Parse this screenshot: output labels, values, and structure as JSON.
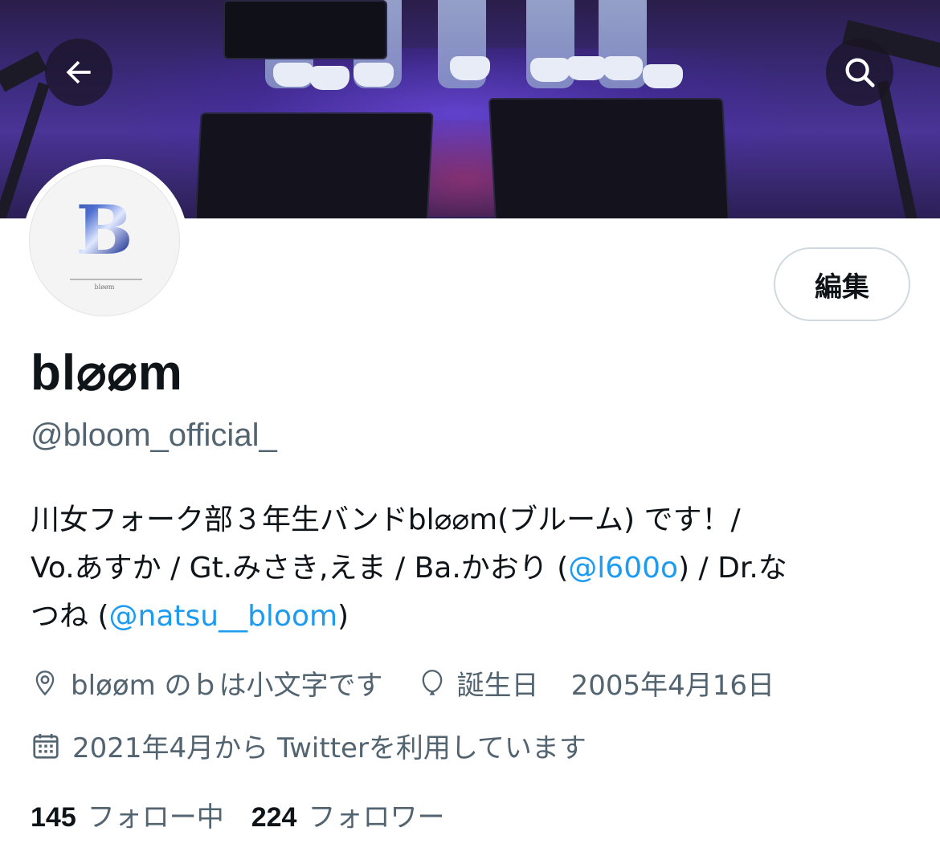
{
  "header": {
    "back_icon": "arrow-left-icon",
    "search_icon": "search-icon"
  },
  "profile": {
    "avatar_letter": "B",
    "avatar_caption": "bløøm",
    "edit_label": "編集",
    "display_name": "bl⌀⌀m",
    "handle": "@bloom_official_"
  },
  "bio": {
    "line1": "川女フォーク部３年生バンドbl⌀⌀m(ブルーム) です！/",
    "line2_pre": "Vo.あすか / Gt.みさき,えま / Ba.かおり (",
    "line2_link": "@l600o",
    "line2_post": ") / Dr.な",
    "line3_pre": "つね (",
    "line3_link": "@natsu__bloom",
    "line3_post": ")"
  },
  "meta": {
    "location_icon": "location-pin-icon",
    "location": "bløøm のｂは小文字です",
    "birthday_icon": "balloon-icon",
    "birthday_label": "誕生日",
    "birthday_date": "2005年4月16日",
    "joined_icon": "calendar-icon",
    "joined": "2021年4月から Twitterを利用しています"
  },
  "stats": {
    "following_count": "145",
    "following_label": "フォロー中",
    "followers_count": "224",
    "followers_label": "フォロワー"
  },
  "colors": {
    "link": "#1d9bf0",
    "secondary_text": "#536471",
    "primary_text": "#0f1419"
  }
}
